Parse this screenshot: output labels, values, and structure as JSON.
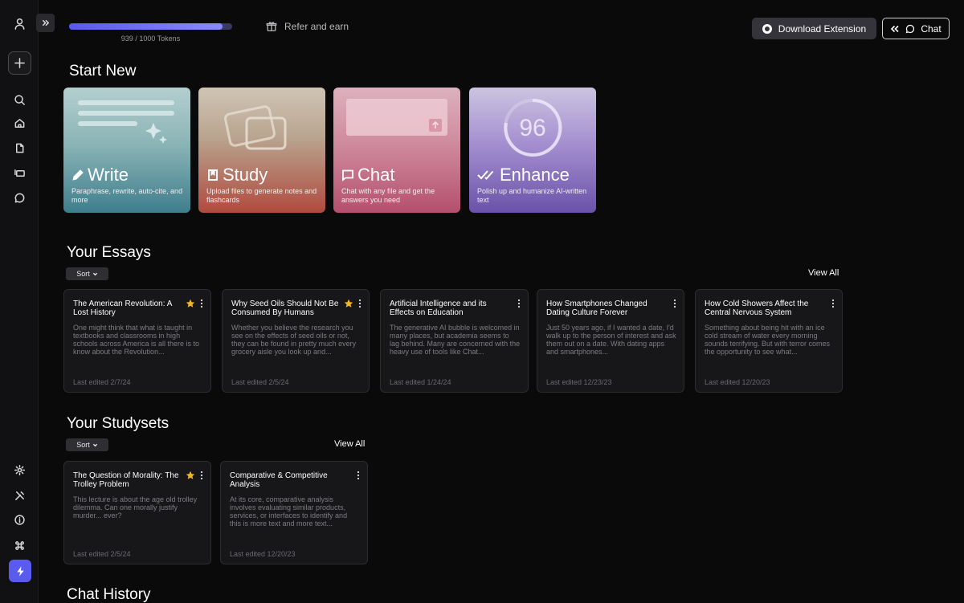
{
  "topbar": {
    "tokens_text": "939 / 1000 Tokens",
    "tokens_used": 939,
    "tokens_max": 1000,
    "refer_label": "Refer and earn",
    "download_label": "Download Extension",
    "chat_label": "Chat"
  },
  "start_new": {
    "heading": "Start New",
    "cards": [
      {
        "title": "Write",
        "desc": "Paraphrase, rewrite, auto-cite, and more"
      },
      {
        "title": "Study",
        "desc": "Upload files to generate notes and flashcards"
      },
      {
        "title": "Chat",
        "desc": "Chat with any file and get the answers you need"
      },
      {
        "title": "Enhance",
        "desc": "Polish up and humanize AI-written text",
        "badge": "96"
      }
    ]
  },
  "essays": {
    "heading": "Your Essays",
    "sort_label": "Sort",
    "view_all": "View All",
    "items": [
      {
        "title": "The American Revolution: A Lost History",
        "starred": true,
        "body": "One might think that what is taught in textbooks and classrooms in high schools across America is all there is to know about the Revolution...",
        "date": "Last edited 2/7/24"
      },
      {
        "title": "Why Seed Oils Should Not Be Consumed By Humans",
        "starred": true,
        "body": "Whether you believe the research you see on the effects of seed oils or not, they can be found in pretty much every grocery aisle you look up and...",
        "date": "Last edited 2/5/24"
      },
      {
        "title": "Artificial Intelligence and its Effects on Education",
        "starred": false,
        "body": "The generative AI bubble is welcomed in many places, but academia seems to lag behind. Many are concerned with the heavy use of tools like Chat...",
        "date": "Last edited 1/24/24"
      },
      {
        "title": "How Smartphones Changed Dating Culture Forever",
        "starred": false,
        "body": "Just 50 years ago, if I wanted a date, I'd walk up to the person of interest and ask them out on a date. With dating apps and smartphones...",
        "date": "Last edited 12/23/23"
      },
      {
        "title": "How Cold Showers Affect the Central Nervous System",
        "starred": false,
        "body": "Something about being hit with an ice cold stream of water every morning sounds terrifying. But with terror comes the opportunity to see what...",
        "date": "Last edited 12/20/23"
      }
    ]
  },
  "studysets": {
    "heading": "Your Studysets",
    "sort_label": "Sort",
    "view_all": "View All",
    "items": [
      {
        "title": "The Question of Morality: The Trolley Problem",
        "starred": true,
        "body": "This lecture is about the age old trolley dilemma. Can one morally justify murder... ever?",
        "date": "Last edited 2/5/24"
      },
      {
        "title": "Comparative & Competitive Analysis",
        "starred": false,
        "body": "At its core, comparative analysis involves evaluating similar products, services, or interfaces to identify and this is more text and more text...",
        "date": "Last edited 12/20/23"
      }
    ]
  },
  "chat_history": {
    "heading": "Chat History"
  }
}
